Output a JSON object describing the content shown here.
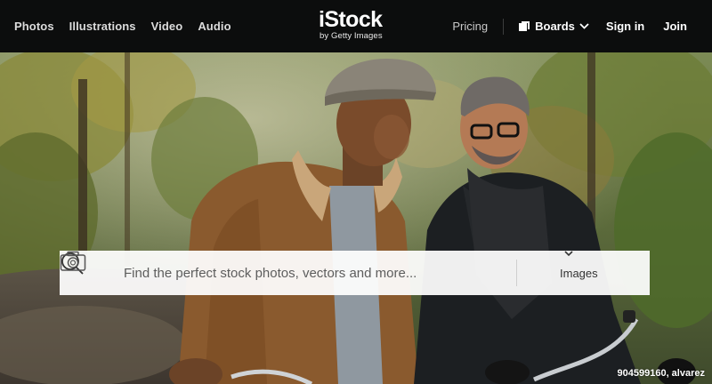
{
  "nav": {
    "left_links": [
      "Photos",
      "Illustrations",
      "Video",
      "Audio"
    ],
    "pricing": "Pricing",
    "boards": "Boards",
    "signin": "Sign in",
    "join": "Join"
  },
  "logo": {
    "word": "iStock",
    "sub": "by Getty Images"
  },
  "search": {
    "placeholder": "Find the perfect stock photos, vectors and more...",
    "value": "",
    "type_selected": "Images",
    "icon": "search-icon",
    "camera_icon": "camera-icon"
  },
  "hero": {
    "caption": "904599160, alvarez"
  },
  "colors": {
    "topbar_bg": "#0c0d0d",
    "nav_text": "#dcdcdc",
    "search_bg": "#ffffff"
  }
}
